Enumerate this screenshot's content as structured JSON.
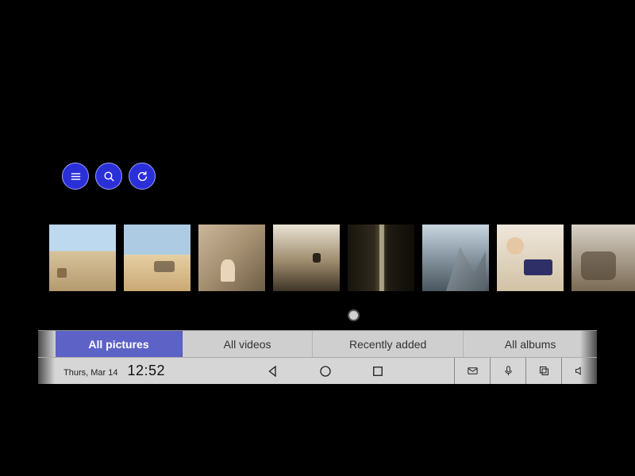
{
  "fab_buttons": [
    {
      "name": "menu-icon"
    },
    {
      "name": "search-icon"
    },
    {
      "name": "refresh-icon"
    }
  ],
  "thumbnails": [
    {
      "name": "photo-beach-canopy",
      "style": "beach1"
    },
    {
      "name": "photo-beach-family",
      "style": "beach2"
    },
    {
      "name": "photo-rock-sitting",
      "style": "rocks"
    },
    {
      "name": "photo-cliff-edge",
      "style": "cliff"
    },
    {
      "name": "photo-forest-sunlight",
      "style": "forest"
    },
    {
      "name": "photo-mountain",
      "style": "mountain"
    },
    {
      "name": "photo-kids-tablet",
      "style": "family"
    },
    {
      "name": "photo-group",
      "style": "group"
    }
  ],
  "tabs": [
    {
      "label": "All pictures",
      "active": true
    },
    {
      "label": "All videos",
      "active": false
    },
    {
      "label": "Recently added",
      "active": false
    },
    {
      "label": "All albums",
      "active": false
    }
  ],
  "status": {
    "date": "Thurs, Mar 14",
    "time": "12:52"
  },
  "nav_buttons": [
    {
      "name": "back-button"
    },
    {
      "name": "home-button"
    },
    {
      "name": "recent-apps-button"
    }
  ],
  "system_buttons": [
    {
      "name": "mail-icon"
    },
    {
      "name": "microphone-icon"
    },
    {
      "name": "copy-icon"
    },
    {
      "name": "volume-icon"
    }
  ],
  "colors": {
    "accent": "#2b2fd8",
    "tab_active": "#5c62c6"
  }
}
